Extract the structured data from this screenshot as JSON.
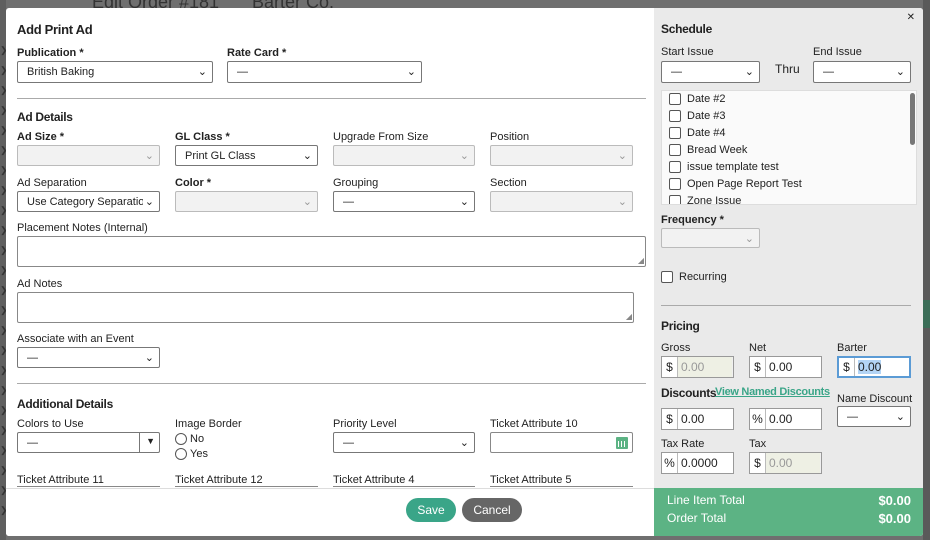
{
  "background": {
    "title": "Edit Order #181",
    "company": "Barter Co."
  },
  "modal": {
    "title": "Add Print Ad",
    "publication": {
      "label": "Publication *",
      "value": "British Baking"
    },
    "rate_card": {
      "label": "Rate Card *",
      "value": "—"
    },
    "ad_details": {
      "heading": "Ad Details",
      "ad_size": {
        "label": "Ad Size *",
        "value": ""
      },
      "gl_class": {
        "label": "GL Class *",
        "value": "Print GL Class"
      },
      "upgrade_from_size": {
        "label": "Upgrade From Size",
        "value": ""
      },
      "position": {
        "label": "Position",
        "value": ""
      },
      "ad_separation": {
        "label": "Ad Separation",
        "value": "Use Category Separation"
      },
      "color": {
        "label": "Color *",
        "value": ""
      },
      "grouping": {
        "label": "Grouping",
        "value": "—"
      },
      "section": {
        "label": "Section",
        "value": ""
      },
      "placement_notes": {
        "label": "Placement Notes (Internal)",
        "value": ""
      },
      "ad_notes": {
        "label": "Ad Notes",
        "value": ""
      },
      "associate_event": {
        "label": "Associate with an Event",
        "value": "—"
      }
    },
    "additional": {
      "heading": "Additional Details",
      "colors_to_use": {
        "label": "Colors to Use",
        "value": "—"
      },
      "image_border": {
        "label": "Image Border",
        "options": [
          "No",
          "Yes"
        ]
      },
      "priority_level": {
        "label": "Priority Level",
        "value": "—"
      },
      "ticket_attr_10": {
        "label": "Ticket Attribute 10",
        "value": ""
      },
      "ticket_attr_11": {
        "label": "Ticket Attribute 11"
      },
      "ticket_attr_12": {
        "label": "Ticket Attribute 12"
      },
      "ticket_attr_4": {
        "label": "Ticket Attribute 4"
      },
      "ticket_attr_5": {
        "label": "Ticket Attribute 5"
      }
    },
    "buttons": {
      "save": "Save",
      "cancel": "Cancel"
    }
  },
  "schedule": {
    "heading": "Schedule",
    "start_issue": {
      "label": "Start Issue",
      "value": "—"
    },
    "thru": "Thru",
    "end_issue": {
      "label": "End Issue",
      "value": "—"
    },
    "issues": [
      "Date #2",
      "Date #3",
      "Date #4",
      "Bread Week",
      "issue template test",
      "Open Page Report Test",
      "Zone Issue"
    ],
    "frequency": {
      "label": "Frequency *",
      "value": ""
    },
    "recurring": "Recurring"
  },
  "pricing": {
    "heading": "Pricing",
    "gross": {
      "label": "Gross",
      "prefix": "$",
      "value": "0.00"
    },
    "net": {
      "label": "Net",
      "prefix": "$",
      "value": "0.00"
    },
    "barter": {
      "label": "Barter",
      "prefix": "$",
      "value": "0.00"
    },
    "discounts_label": "Discounts",
    "view_named_discounts": "View Named Discounts",
    "discount_amount": {
      "prefix": "$",
      "value": "0.00"
    },
    "discount_percent": {
      "prefix": "%",
      "value": "0.00"
    },
    "name_discount": {
      "label": "Name Discount",
      "value": "—"
    },
    "tax_rate": {
      "label": "Tax Rate",
      "prefix": "%",
      "value": "0.0000"
    },
    "tax": {
      "label": "Tax",
      "prefix": "$",
      "value": "0.00"
    }
  },
  "totals": {
    "line_item_label": "Line Item Total",
    "line_item_value": "$0.00",
    "order_label": "Order Total",
    "order_value": "$0.00"
  },
  "colors": {
    "accent": "#3aa588",
    "footer": "#5cb384",
    "save_button": "#3aa588",
    "cancel_button": "#666666"
  }
}
